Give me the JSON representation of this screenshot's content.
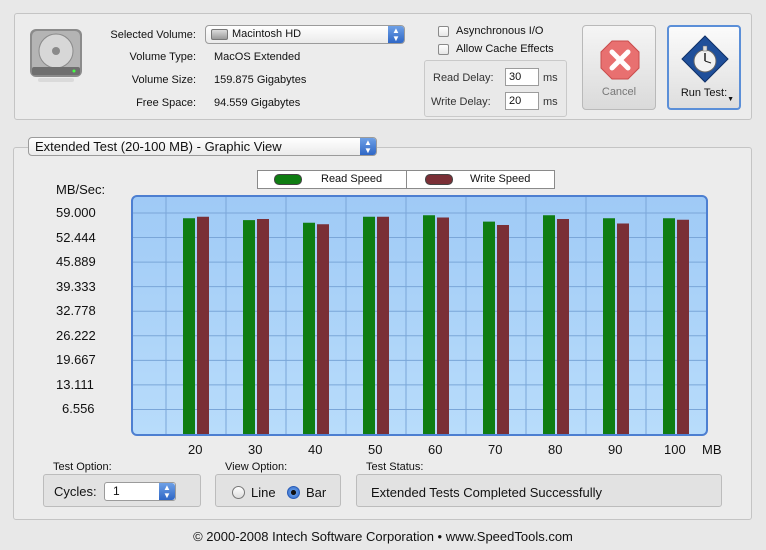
{
  "volume": {
    "selected_label": "Selected Volume:",
    "selected_value": "Macintosh HD",
    "type_label": "Volume Type:",
    "type_value": "MacOS Extended",
    "size_label": "Volume Size:",
    "size_value": "159.875 Gigabytes",
    "free_label": "Free Space:",
    "free_value": "94.559 Gigabytes"
  },
  "options": {
    "async_label": "Asynchronous I/O",
    "cache_label": "Allow Cache Effects",
    "async_checked": false,
    "cache_checked": false,
    "read_delay_label": "Read Delay:",
    "read_delay_value": "30",
    "write_delay_label": "Write Delay:",
    "write_delay_value": "20",
    "ms": "ms"
  },
  "buttons": {
    "cancel": "Cancel",
    "run": "Run Test:"
  },
  "view_select": "Extended Test (20-100 MB) - Graphic View",
  "legend": {
    "read": "Read Speed",
    "write": "Write Speed"
  },
  "colors": {
    "read": "#0f7d12",
    "write": "#7a2f36",
    "plot_border": "#4d7fd1"
  },
  "chart_data": {
    "type": "bar",
    "ylabel": "MB/Sec:",
    "xunit": "MB",
    "categories": [
      "20",
      "30",
      "40",
      "50",
      "60",
      "70",
      "80",
      "90",
      "100"
    ],
    "y_ticks": [
      "59.000",
      "52.444",
      "45.889",
      "39.333",
      "32.778",
      "26.222",
      "19.667",
      "13.111",
      "6.556"
    ],
    "ylim": [
      0,
      59
    ],
    "grid": true,
    "legend_position": "top-center",
    "series": [
      {
        "name": "Read Speed",
        "values": [
          57.6,
          57.1,
          56.4,
          58.0,
          58.4,
          56.7,
          58.4,
          57.6,
          57.6
        ]
      },
      {
        "name": "Write Speed",
        "values": [
          58.0,
          57.4,
          56.0,
          58.0,
          57.8,
          55.8,
          57.4,
          56.2,
          57.2
        ]
      }
    ]
  },
  "test_option": {
    "label": "Test Option:",
    "cycles_label": "Cycles:",
    "cycles_value": "1"
  },
  "view_option": {
    "label": "View Option:",
    "line": "Line",
    "bar": "Bar",
    "selected": "Bar"
  },
  "test_status": {
    "label": "Test Status:",
    "value": "Extended Tests Completed Successfully"
  },
  "footer": "© 2000-2008 Intech Software Corporation • www.SpeedTools.com"
}
